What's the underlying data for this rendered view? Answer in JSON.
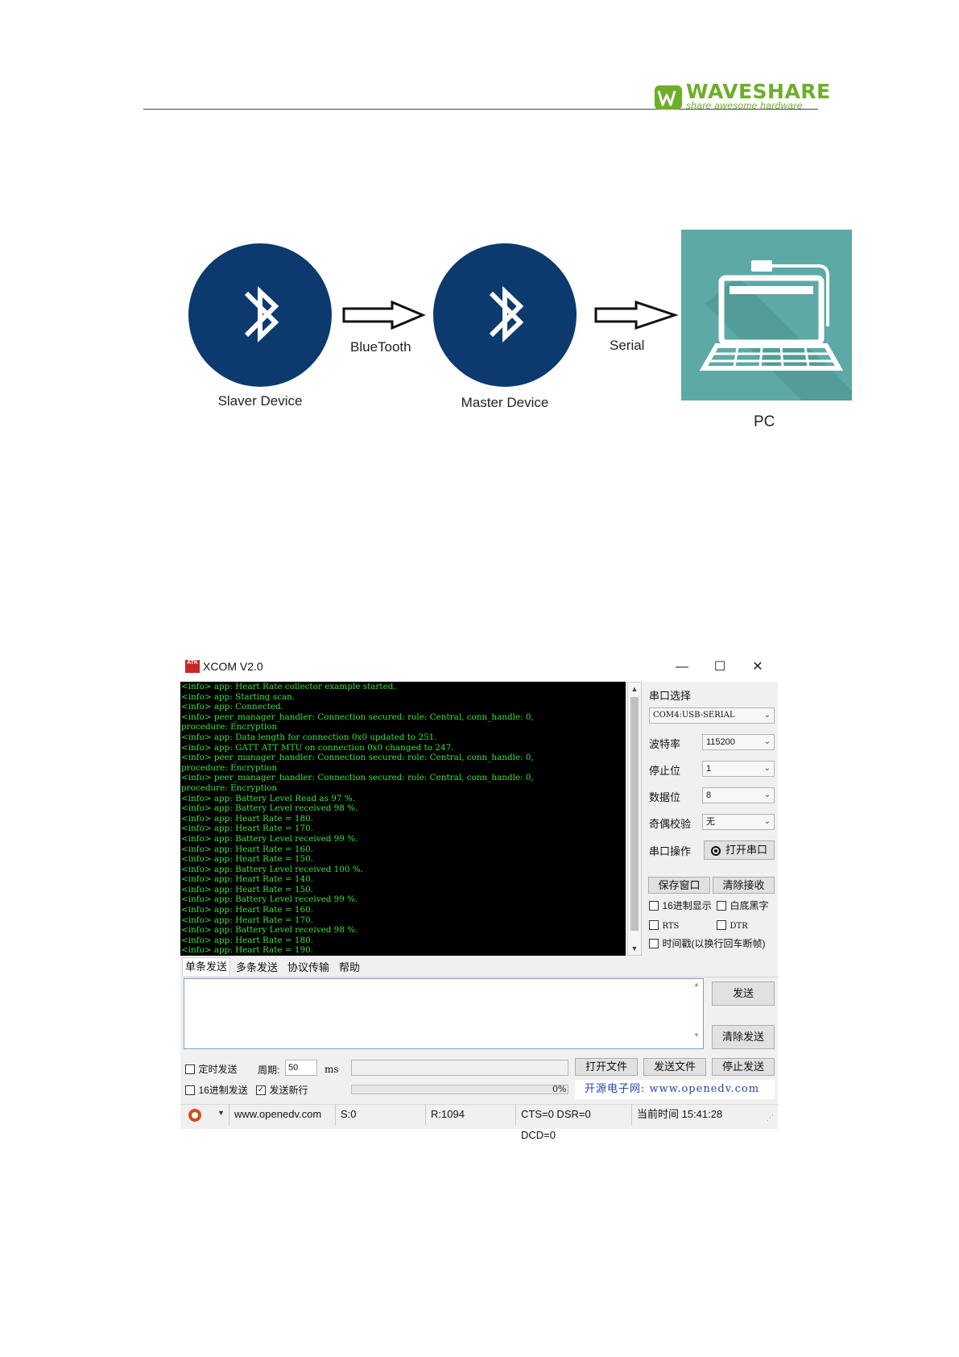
{
  "header": {
    "logo_text": "WAVESHARE",
    "logo_tagline": "share awesome hardware"
  },
  "diagram": {
    "nodes": [
      "Slaver Device",
      "Master Device",
      "PC"
    ],
    "edges": [
      "BlueTooth",
      "Serial"
    ]
  },
  "xcom": {
    "title": "XCOM V2.0",
    "icon_text": "ATK",
    "window_controls": [
      "minimize-icon",
      "maximize-icon",
      "close-icon"
    ],
    "terminal_lines": [
      "<info> app: Heart Rate collector example started.",
      "<info> app: Starting scan.",
      "<info> app: Connected.",
      "<info> peer_manager_handler: Connection secured: role: Central, conn_handle: 0,",
      "procedure: Encryption",
      "<info> app: Data length for connection 0x0 updated to 251.",
      "<info> app: GATT ATT MTU on connection 0x0 changed to 247.",
      "<info> peer_manager_handler: Connection secured: role: Central, conn_handle: 0,",
      "procedure: Encryption",
      "<info> peer_manager_handler: Connection secured: role: Central, conn_handle: 0,",
      "procedure: Encryption",
      "<info> app: Battery Level Read as 97 %.",
      "<info> app: Battery Level received 98 %.",
      "<info> app: Heart Rate = 180.",
      "<info> app: Heart Rate = 170.",
      "<info> app: Battery Level received 99 %.",
      "<info> app: Heart Rate = 160.",
      "<info> app: Heart Rate = 150.",
      "<info> app: Battery Level received 100 %.",
      "<info> app: Heart Rate = 140.",
      "<info> app: Heart Rate = 150.",
      "<info> app: Battery Level received 99 %.",
      "<info> app: Heart Rate = 160.",
      "<info> app: Heart Rate = 170.",
      "<info> app: Battery Level received 98 %.",
      "<info> app: Heart Rate = 180.",
      "<info> app: Heart Rate = 190."
    ],
    "right_panel": {
      "port_select_label": "串口选择",
      "port_value": "COM4:USB-SERIAL",
      "baud_label": "波特率",
      "baud_value": "115200",
      "stop_bits_label": "停止位",
      "stop_bits_value": "1",
      "data_bits_label": "数据位",
      "data_bits_value": "8",
      "parity_label": "奇偶校验",
      "parity_value": "无",
      "port_op_label": "串口操作",
      "open_port_button": "打开串口",
      "save_window_button": "保存窗口",
      "clear_receive_button": "清除接收",
      "hex_display_label": "16进制显示",
      "white_bg_label": "白底黑字",
      "rts_label": "RTS",
      "dtr_label": "DTR",
      "timestamp_label": "时间戳(以换行回车断帧)"
    },
    "tabs": [
      "单条发送",
      "多条发送",
      "协议传输",
      "帮助"
    ],
    "send": {
      "send_button": "发送",
      "clear_send_button": "清除发送",
      "timed_send_label": "定时发送",
      "period_label": "周期:",
      "period_value": "50",
      "period_unit": "ms",
      "hex_send_label": "16进制发送",
      "send_newline_label": "发送新行",
      "open_file_button": "打开文件",
      "send_file_button": "发送文件",
      "stop_send_button": "停止发送",
      "progress_text": "0%",
      "progress_value": 0,
      "promo_text": "开源电子网: www.openedv.com"
    },
    "status_bar": {
      "url": "www.openedv.com",
      "sent": "S:0",
      "received": "R:1094",
      "signals": "CTS=0 DSR=0 DCD=0",
      "time": "当前时间 15:41:28"
    }
  }
}
